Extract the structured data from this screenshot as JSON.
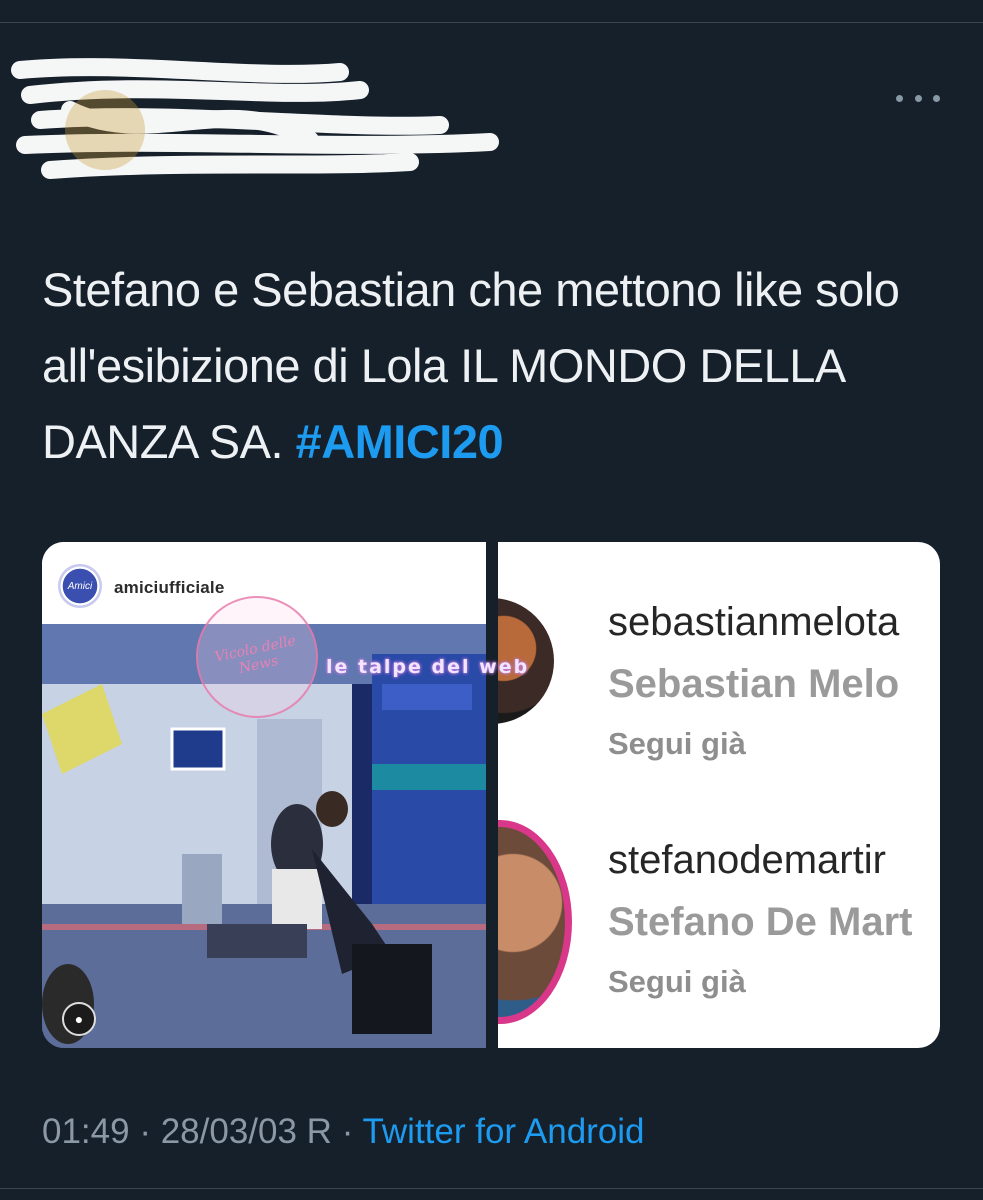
{
  "tweet": {
    "more_label": "More",
    "text_main": "Stefano e Sebastian che mettono like solo all'esibizione di Lola IL MONDO DELLA DANZA SA. ",
    "hashtag": "#AMICI20",
    "time": "01:49",
    "sep": "·",
    "date": "28/03/03 R",
    "source": "Twitter for Android"
  },
  "media": {
    "left": {
      "username": "amiciufficiale",
      "avatar_text": "Amici"
    },
    "right": {
      "accounts": [
        {
          "username": "sebastianmelota",
          "name": "Sebastian Melo",
          "status": "Segui già"
        },
        {
          "username": "stefanodemartir",
          "name": "Stefano De Mart",
          "status": "Segui già"
        }
      ]
    },
    "watermarks": {
      "left": "Vicolo delle News",
      "right": "le talpe del web"
    }
  },
  "colors": {
    "background": "#16202b",
    "text": "#eef1f3",
    "link": "#1d9bf0",
    "muted": "#8b98a5"
  }
}
